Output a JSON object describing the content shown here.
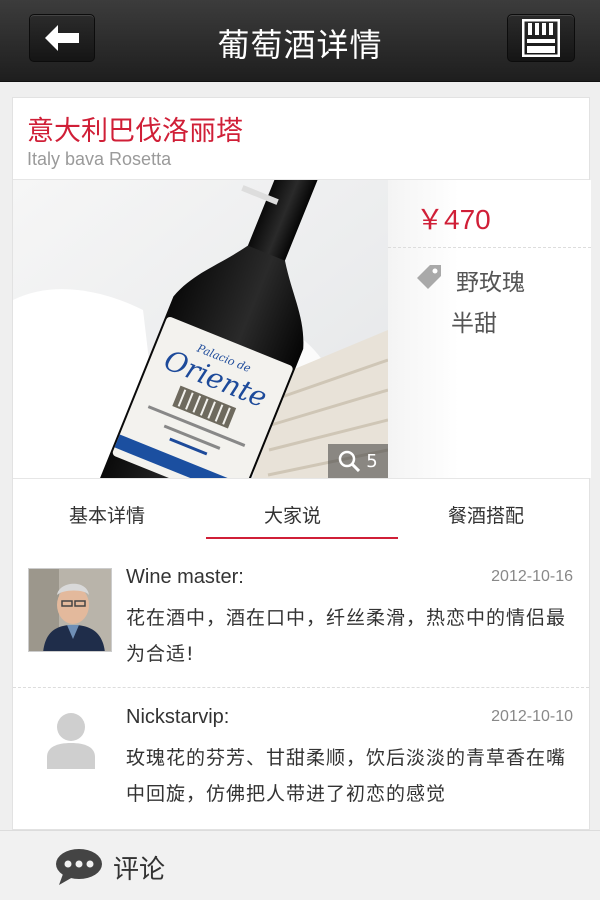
{
  "header": {
    "title": "葡萄酒详情",
    "back_icon": "back-arrow-icon",
    "menu_icon": "grid-menu-icon"
  },
  "wine": {
    "name_cn": "意大利巴伐洛丽塔",
    "name_en": "Italy bava Rosetta",
    "price": "￥470",
    "image_count": "5",
    "attributes": [
      "野玫瑰",
      "半甜"
    ],
    "label_text": "Oriente",
    "label_subtext": "Palacio de"
  },
  "tabs": [
    {
      "label": "基本详情",
      "active": false
    },
    {
      "label": "大家说",
      "active": true
    },
    {
      "label": "餐酒搭配",
      "active": false
    }
  ],
  "comments": [
    {
      "author": "Wine master:",
      "date": "2012-10-16",
      "text": "花在酒中，酒在口中，纤丝柔滑，热恋中的情侣最为合适!"
    },
    {
      "author": "Nickstarvip:",
      "date": "2012-10-10",
      "text": "玫瑰花的芬芳、甘甜柔顺，饮后淡淡的青草香在嘴中回旋，仿佛把人带进了初恋的感觉"
    }
  ],
  "footer": {
    "comment_label": "评论"
  },
  "colors": {
    "accent": "#d01f37",
    "header_bg": "#2a2a2a"
  }
}
